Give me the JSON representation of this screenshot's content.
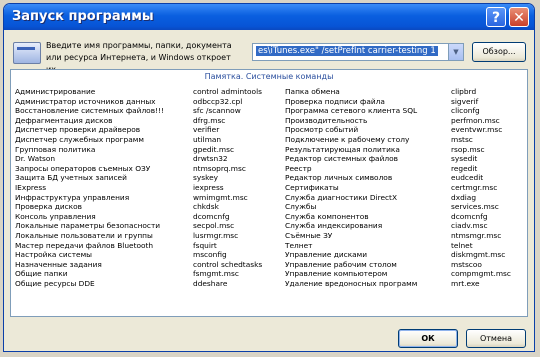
{
  "window": {
    "title": "Запуск программы",
    "help_glyph": "?",
    "close_glyph": "✕"
  },
  "prompt": "Введите имя программы, папки, документа или ресурса Интернета, и Windows откроет их.",
  "command": {
    "value": "es\\iTunes.exe\" /setPrefInt carrier-testing 1"
  },
  "buttons": {
    "browse": "Обзор...",
    "ok": "ОК",
    "cancel": "Отмена"
  },
  "list_caption": "Памятка. Системные команды",
  "commands": [
    {
      "name": "Администрирование",
      "cmd": "control admintools",
      "name2": "Папка обмена",
      "cmd2": "clipbrd"
    },
    {
      "name": "Администратор источников данных",
      "cmd": "odbccp32.cpl",
      "name2": "Проверка подписи файла",
      "cmd2": "sigverif"
    },
    {
      "name": "Восстановление системных файлов!!!",
      "cmd": "sfc /scannow",
      "name2": "Программа сетевого клиента SQL",
      "cmd2": "cliconfg"
    },
    {
      "name": "Дефрагментация дисков",
      "cmd": "dfrg.msc",
      "name2": "Производительность",
      "cmd2": "perfmon.msc"
    },
    {
      "name": "Диспетчер проверки драйверов",
      "cmd": "verifier",
      "name2": "Просмотр событий",
      "cmd2": "eventvwr.msc"
    },
    {
      "name": "Диспетчер служебных программ",
      "cmd": "utilman",
      "name2": "Подключение к рабочему столу",
      "cmd2": "mstsc"
    },
    {
      "name": "Групповая политика",
      "cmd": "gpedit.msc",
      "name2": "Результатирующая политика",
      "cmd2": "rsop.msc"
    },
    {
      "name": "Dr. Watson",
      "cmd": "drwtsn32",
      "name2": "Редактор системных файлов",
      "cmd2": "sysedit"
    },
    {
      "name": "Запросы операторов съемных ОЗУ",
      "cmd": "ntmsoprq.msc",
      "name2": "Реестр",
      "cmd2": "regedit"
    },
    {
      "name": "Защита БД учетных записей",
      "cmd": "syskey",
      "name2": "Редактор личных символов",
      "cmd2": "eudcedit"
    },
    {
      "name": "IExpress",
      "cmd": "iexpress",
      "name2": "Сертификаты",
      "cmd2": "certmgr.msc"
    },
    {
      "name": "Инфраструктура управления",
      "cmd": "wmimgmt.msc",
      "name2": "Служба диагностики DirectX",
      "cmd2": "dxdiag"
    },
    {
      "name": "Проверка дисков",
      "cmd": "chkdsk",
      "name2": "Службы",
      "cmd2": "services.msc"
    },
    {
      "name": "Консоль управления",
      "cmd": "dcomcnfg",
      "name2": "Служба компонентов",
      "cmd2": "dcomcnfg"
    },
    {
      "name": "Локальные параметры безопасности",
      "cmd": "secpol.msc",
      "name2": "Служба индексирования",
      "cmd2": "ciadv.msc"
    },
    {
      "name": "Локальные пользователи и группы",
      "cmd": "lusrmgr.msc",
      "name2": "Съёмные ЗУ",
      "cmd2": "ntmsmgr.msc"
    },
    {
      "name": "Мастер передачи файлов Bluetooth",
      "cmd": "fsquirt",
      "name2": "Телнет",
      "cmd2": "telnet"
    },
    {
      "name": "Настройка системы",
      "cmd": "msconfig",
      "name2": "Управление дисками",
      "cmd2": "diskmgmt.msc"
    },
    {
      "name": "Назначенные задания",
      "cmd": "control schedtasks",
      "name2": "Управление рабочим столом",
      "cmd2": "mstscoo"
    },
    {
      "name": "Общие папки",
      "cmd": "fsmgmt.msc",
      "name2": "Управление компьютером",
      "cmd2": "compmgmt.msc"
    },
    {
      "name": "Общие ресурсы DDE",
      "cmd": "ddeshare",
      "name2": "Удаление вредоносных программ",
      "cmd2": "mrt.exe"
    }
  ]
}
